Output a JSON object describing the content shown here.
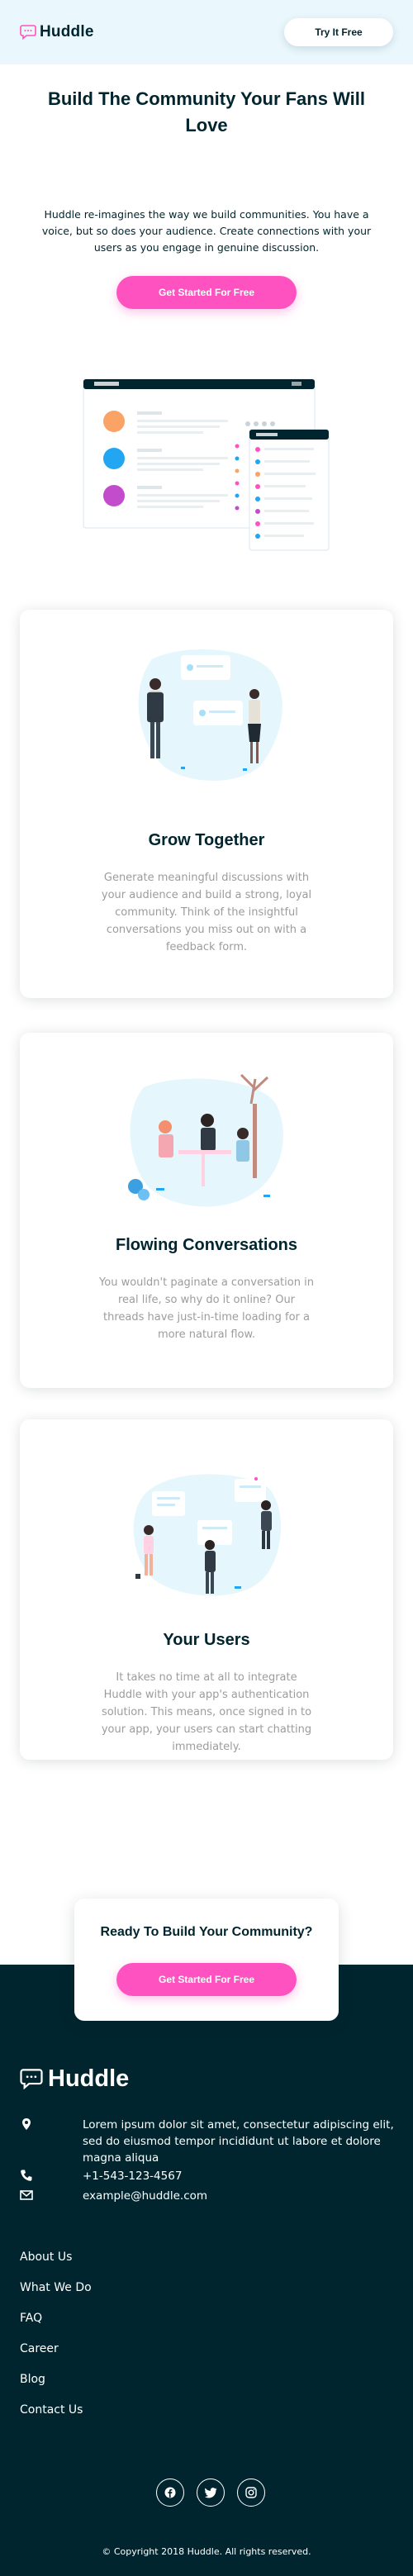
{
  "header": {
    "brand": "Huddle",
    "try_button": "Try It Free"
  },
  "hero": {
    "title": "Build The Community Your Fans Will Love",
    "text": "Huddle re-imagines the way we build communities. You have a voice, but so does your audience. Create connections with your users as you engage in genuine discussion.",
    "cta": "Get Started For Free"
  },
  "features": [
    {
      "title": "Grow Together",
      "text": "Generate meaningful discussions with your audience and build a strong, loyal community. Think of the insightful conversations you miss out on with a feedback form."
    },
    {
      "title": "Flowing Conversations",
      "text": "You wouldn't paginate a conversation in real life, so why do it online? Our threads have just-in-time loading for a more natural flow."
    },
    {
      "title": "Your Users",
      "text": "It takes no time at all to integrate Huddle with your app's authentication solution. This means, once signed in to your app, your users can start chatting immediately."
    }
  ],
  "ready": {
    "title": "Ready To Build Your Community?",
    "cta": "Get Started For Free"
  },
  "footer": {
    "brand": "Huddle",
    "address": "Lorem ipsum dolor sit amet, consectetur adipiscing elit, sed do eiusmod tempor incididunt ut labore et dolore magna aliqua",
    "phone": "+1-543-123-4567",
    "email": "example@huddle.com",
    "links": [
      "About Us",
      "What We Do",
      "FAQ",
      "Career",
      "Blog",
      "Contact Us"
    ],
    "social": [
      "facebook-icon",
      "twitter-icon",
      "instagram-icon"
    ],
    "copyright": "© Copyright 2018 Huddle. All rights reserved."
  },
  "colors": {
    "pink": "#ff52c1",
    "dark_cyan": "#00252e",
    "light_blue": "#eaf8fe",
    "grey_text": "#9c9c9c"
  }
}
